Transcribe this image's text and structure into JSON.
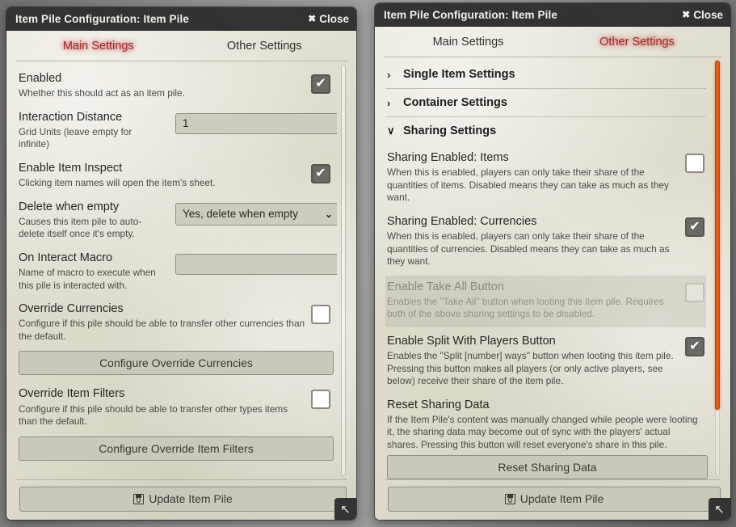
{
  "windows": {
    "left": {
      "title": "Item Pile Configuration: Item Pile",
      "close_label": "Close",
      "tabs": [
        {
          "label": "Main Settings",
          "active": true
        },
        {
          "label": "Other Settings",
          "active": false
        }
      ],
      "fields": [
        {
          "title": "Enabled",
          "hint": "Whether this should act as an item pile.",
          "control": "checkbox",
          "value": true
        },
        {
          "title": "Interaction Distance",
          "hint": "Grid Units (leave empty for infinite)",
          "control": "text",
          "value": "1",
          "placeholder": ""
        },
        {
          "title": "Enable Item Inspect",
          "hint": "Clicking item names will open the item's sheet.",
          "control": "checkbox",
          "value": true
        },
        {
          "title": "Delete when empty",
          "hint": "Causes this item pile to auto-delete itself once it's empty.",
          "control": "select",
          "value": "Yes, delete when empty"
        },
        {
          "title": "On Interact Macro",
          "hint": "Name of macro to execute when this pile is interacted with.",
          "control": "text",
          "value": "",
          "placeholder": ""
        },
        {
          "title": "Override Currencies",
          "hint": "Configure if this pile should be able to transfer other currencies than the default.",
          "control": "checkbox",
          "value": false,
          "button_label": "Configure Override Currencies"
        },
        {
          "title": "Override Item Filters",
          "hint": "Configure if this pile should be able to transfer other types items than the default.",
          "control": "checkbox",
          "value": false,
          "button_label": "Configure Override Item Filters"
        }
      ],
      "footer_button": "Update Item Pile",
      "scrollbar": "plain"
    },
    "right": {
      "title": "Item Pile Configuration: Item Pile",
      "close_label": "Close",
      "tabs": [
        {
          "label": "Main Settings",
          "active": false
        },
        {
          "label": "Other Settings",
          "active": true
        }
      ],
      "sections": [
        {
          "title": "Single Item Settings",
          "expanded": false,
          "chevron": "›"
        },
        {
          "title": "Container Settings",
          "expanded": false,
          "chevron": "›"
        },
        {
          "title": "Sharing Settings",
          "expanded": true,
          "chevron": "∨"
        }
      ],
      "fields": [
        {
          "title": "Sharing Enabled: Items",
          "hint": "When this is enabled, players can only take their share of the quantities of items. Disabled means they can take as much as they want.",
          "control": "checkbox",
          "value": false,
          "disabled": false
        },
        {
          "title": "Sharing Enabled: Currencies",
          "hint": "When this is enabled, players can only take their share of the quantities of currencies. Disabled means they can take as much as they want.",
          "control": "checkbox",
          "value": true,
          "disabled": false
        },
        {
          "title": "Enable Take All Button",
          "hint": "Enables the \"Take All\" button when looting this item pile. Requires both of the above sharing settings to be disabled.",
          "control": "checkbox",
          "value": false,
          "disabled": true
        },
        {
          "title": "Enable Split With Players Button",
          "hint": "Enables the \"Split [number] ways\" button when looting this item pile. Pressing this button makes all players (or only active players, see below) receive their share of the item pile.",
          "control": "checkbox",
          "value": true,
          "disabled": false
        },
        {
          "title": "Reset Sharing Data",
          "hint": "If the Item Pile's content was manually changed while people were looting it, the sharing data may become out of sync with the players' actual shares. Pressing this button will reset everyone's share in this pile.",
          "control": "button",
          "button_label": "Reset Sharing Data"
        }
      ],
      "footer_button": "Update Item Pile",
      "scrollbar": "orange"
    }
  },
  "colors": {
    "accent_active_tab": "#9a2d2d",
    "scrollbar_orange": "#e25c17",
    "titlebar": "#343434",
    "sheet": "#e2dfd2"
  },
  "icons": {
    "close": "✖",
    "resize": "↖",
    "select_chevron": "⌄"
  }
}
